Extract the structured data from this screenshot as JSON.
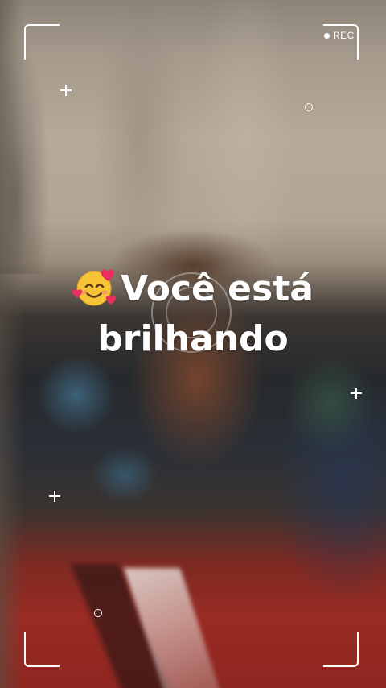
{
  "recorder": {
    "rec_label": "REC"
  },
  "caption": {
    "line1": "Você está",
    "line2": "brilhando",
    "emoji_icon": "smiling-face-with-hearts-emoji"
  },
  "colors": {
    "overlay": "#ffffff",
    "heart": "#e8305e",
    "emoji_face": "#f7c437"
  }
}
